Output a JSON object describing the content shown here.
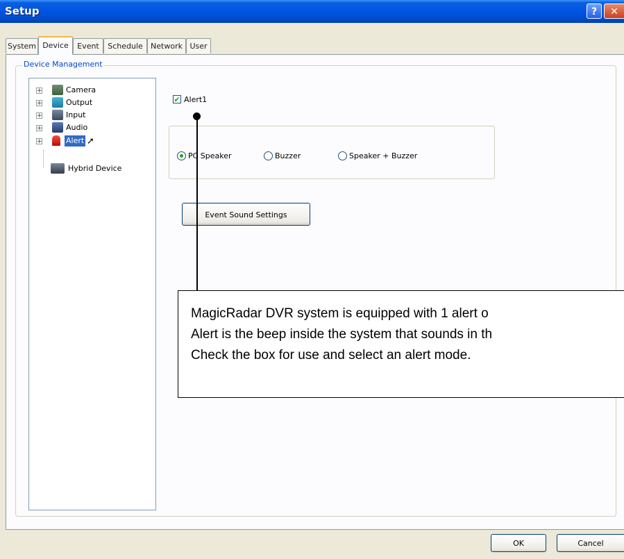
{
  "window": {
    "title": "Setup"
  },
  "tabs": [
    "System",
    "Device",
    "Event",
    "Schedule",
    "Network",
    "User"
  ],
  "active_tab": "Device",
  "group_title": "Device Management",
  "tree": [
    {
      "label": "Camera",
      "icon": "camera-icon",
      "expandable": true
    },
    {
      "label": "Output",
      "icon": "output-icon",
      "expandable": true
    },
    {
      "label": "Input",
      "icon": "input-icon",
      "expandable": true
    },
    {
      "label": "Audio",
      "icon": "audio-icon",
      "expandable": true
    },
    {
      "label": "Alert",
      "icon": "alert-icon",
      "expandable": true,
      "selected": true
    },
    {
      "label": "Hybrid Device",
      "icon": "hybrid-device-icon",
      "expandable": false
    }
  ],
  "alert_checkbox": {
    "label": "Alert1",
    "checked": true
  },
  "alert_modes": [
    {
      "label": "PC Speaker",
      "selected": true
    },
    {
      "label": "Buzzer",
      "selected": false
    },
    {
      "label": "Speaker + Buzzer",
      "selected": false
    }
  ],
  "event_sound_button": "Event Sound Settings",
  "callout": {
    "lines": [
      "MagicRadar DVR system is equipped with 1 alert o",
      "Alert is the beep inside the system that sounds in th",
      "Check the box for use and select an alert mode."
    ]
  },
  "footer": {
    "ok_label": "OK",
    "cancel_label": "Cancel"
  },
  "colors": {
    "titlebar": "#0054e3",
    "selection": "#316ac5",
    "tab_highlight": "#f5b54a"
  }
}
